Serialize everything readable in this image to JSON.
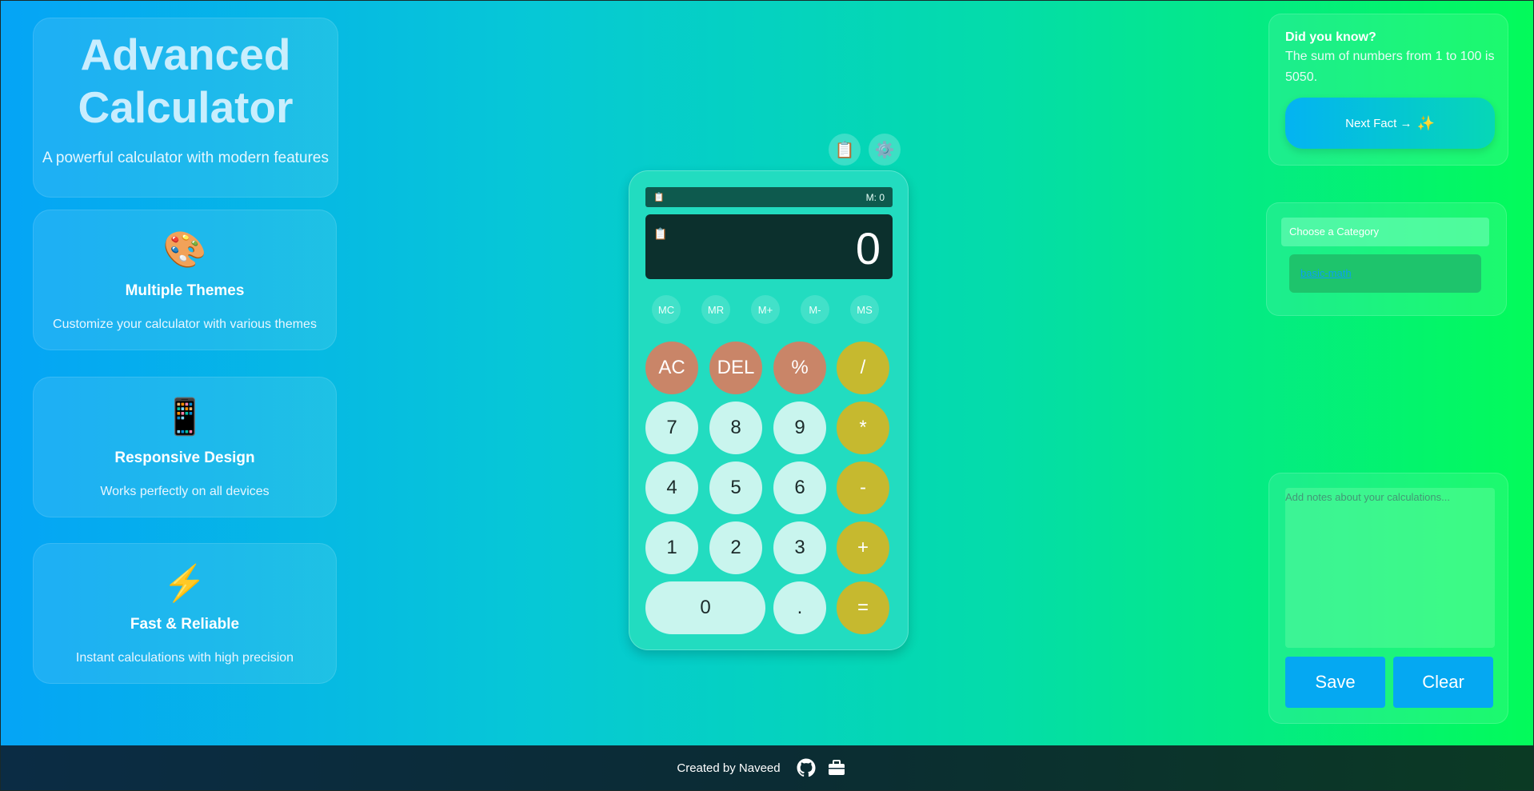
{
  "hero": {
    "title": "Advanced Calculator",
    "subtitle": "A powerful calculator with modern features"
  },
  "features": [
    {
      "icon": "palette-icon",
      "glyph": "🎨",
      "title": "Multiple Themes",
      "desc": "Customize your calculator with various themes"
    },
    {
      "icon": "phone-icon",
      "glyph": "📱",
      "title": "Responsive Design",
      "desc": "Works perfectly on all devices"
    },
    {
      "icon": "lightning-icon",
      "glyph": "⚡",
      "title": "Fast & Reliable",
      "desc": "Instant calculations with high precision"
    }
  ],
  "toolbar": {
    "copy_glyph": "📋",
    "settings_glyph": "⚙️"
  },
  "calculator": {
    "memory_label": "M: 0",
    "history_glyph": "📋",
    "display_value": "0",
    "memory_buttons": [
      "MC",
      "MR",
      "M+",
      "M-",
      "MS"
    ],
    "keys": {
      "ac": "AC",
      "del": "DEL",
      "percent": "%",
      "divide": "/",
      "seven": "7",
      "eight": "8",
      "nine": "9",
      "multiply": "*",
      "four": "4",
      "five": "5",
      "six": "6",
      "minus": "-",
      "one": "1",
      "two": "2",
      "three": "3",
      "plus": "+",
      "zero": "0",
      "dot": ".",
      "equals": "="
    }
  },
  "fact": {
    "heading": "Did you know?",
    "text": "The sum of numbers from 1 to 100 is 5050.",
    "next_label": "Next Fact →",
    "next_glyph": "✨"
  },
  "category": {
    "placeholder": "Choose a Category",
    "items": [
      "basic-math"
    ]
  },
  "notes": {
    "placeholder": "Add notes about your calculations...",
    "save_label": "Save",
    "clear_label": "Clear"
  },
  "footer": {
    "credit": "Created by Naveed"
  },
  "colors": {
    "function_key": "#c98568",
    "operator_key": "#c6b92f",
    "number_key": "#c9f5ee",
    "accent_button": "#05a8f2"
  }
}
